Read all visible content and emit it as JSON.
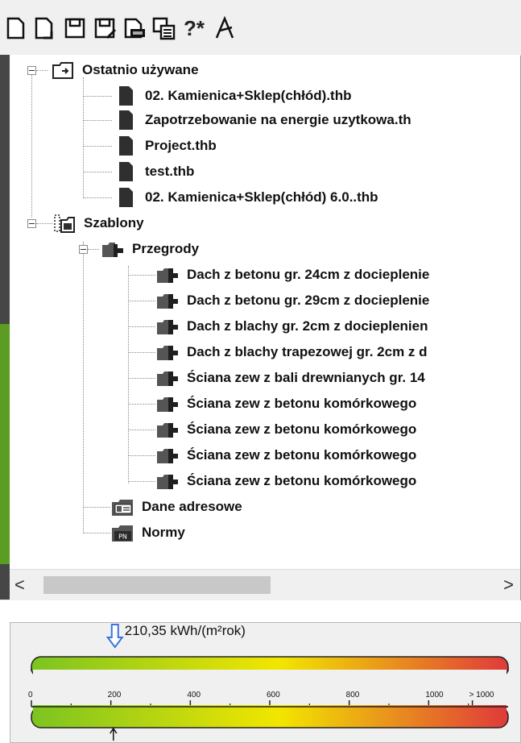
{
  "toolbar": {
    "buttons": [
      {
        "name": "new-file-icon"
      },
      {
        "name": "open-file-icon"
      },
      {
        "name": "save-icon"
      },
      {
        "name": "save-as-icon"
      },
      {
        "name": "export-icon"
      },
      {
        "name": "properties-icon"
      },
      {
        "name": "help-icon",
        "text": "?*"
      },
      {
        "name": "compass-icon",
        "text": "A"
      }
    ]
  },
  "tree": {
    "recent": {
      "label": "Ostatnio używane",
      "items": [
        "02. Kamienica+Sklep(chłód).thb",
        "Zapotrzebowanie na energie uzytkowa.th",
        "Project.thb",
        "test.thb",
        "02. Kamienica+Sklep(chłód) 6.0..thb"
      ]
    },
    "templates": {
      "label": "Szablony",
      "partitions": {
        "label": "Przegrody",
        "items": [
          "Dach z betonu gr. 24cm z docieplenie",
          "Dach z betonu gr. 29cm z docieplenie",
          "Dach z blachy gr. 2cm z docieplenien",
          "Dach z blachy trapezowej gr. 2cm z d",
          "Ściana zew z bali drewnianych gr. 14",
          "Ściana zew z betonu komórkowego",
          "Ściana zew z betonu komórkowego",
          "Ściana zew z betonu komórkowego",
          "Ściana zew z betonu komórkowego"
        ]
      },
      "address": {
        "label": "Dane adresowe"
      },
      "norms": {
        "label": "Normy",
        "badge": "PN"
      }
    }
  },
  "scrollbar": {
    "left": "<",
    "right": ">"
  },
  "gauge": {
    "value_label": "210,35 kWh/(m²rok)",
    "value": 210.35,
    "scale_max": 1200,
    "ticks": [
      {
        "label": "0",
        "value": 0
      },
      {
        "label": "200",
        "value": 200
      },
      {
        "label": "400",
        "value": 400
      },
      {
        "label": "600",
        "value": 600
      },
      {
        "label": "800",
        "value": 800
      },
      {
        "label": "1000",
        "value": 1000
      },
      {
        "label": "> 1000",
        "value": 1110
      }
    ],
    "colors": {
      "green": "#7cc421",
      "yellow": "#f2e600",
      "red": "#e03a3a",
      "marker": "#3a74e0"
    }
  }
}
